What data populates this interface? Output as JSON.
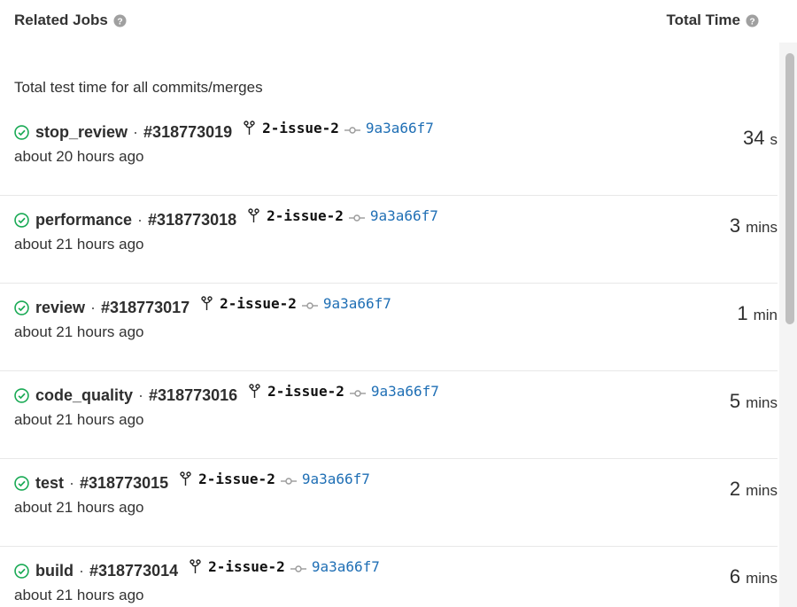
{
  "header": {
    "related_jobs": "Related Jobs",
    "total_time": "Total Time"
  },
  "summary": "Total test time for all commits/merges",
  "jobs": [
    {
      "name": "stop_review",
      "sep": "·",
      "id": "#318773019",
      "branch": "2-issue-2",
      "sha": "9a3a66f7",
      "time_ago": "about 20 hours ago",
      "duration": "34",
      "unit": "s"
    },
    {
      "name": "performance",
      "sep": "·",
      "id": "#318773018",
      "branch": "2-issue-2",
      "sha": "9a3a66f7",
      "time_ago": "about 21 hours ago",
      "duration": "3",
      "unit": "mins"
    },
    {
      "name": "review",
      "sep": "·",
      "id": "#318773017",
      "branch": "2-issue-2",
      "sha": "9a3a66f7",
      "time_ago": "about 21 hours ago",
      "duration": "1",
      "unit": "min"
    },
    {
      "name": "code_quality",
      "sep": "·",
      "id": "#318773016",
      "branch": "2-issue-2",
      "sha": "9a3a66f7",
      "time_ago": "about 21 hours ago",
      "duration": "5",
      "unit": "mins"
    },
    {
      "name": "test",
      "sep": "·",
      "id": "#318773015",
      "branch": "2-issue-2",
      "sha": "9a3a66f7",
      "time_ago": "about 21 hours ago",
      "duration": "2",
      "unit": "mins"
    },
    {
      "name": "build",
      "sep": "·",
      "id": "#318773014",
      "branch": "2-issue-2",
      "sha": "9a3a66f7",
      "time_ago": "about 21 hours ago",
      "duration": "6",
      "unit": "mins"
    }
  ],
  "colors": {
    "success": "#1aaa55",
    "link": "#1f6fb5",
    "muted_icon": "#9a9a9a"
  },
  "icons": {
    "status": "status-success-icon",
    "branch": "branch-icon",
    "commit": "commit-icon",
    "help": "question-circle-icon"
  }
}
